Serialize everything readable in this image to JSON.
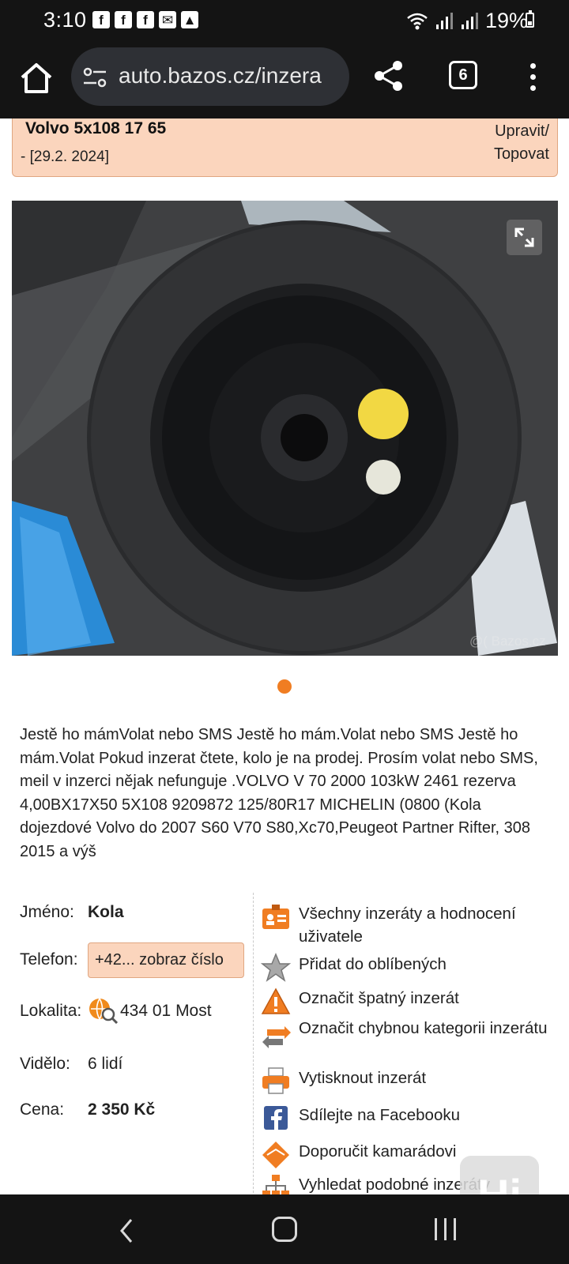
{
  "status_bar": {
    "time": "3:10",
    "notification_icons": [
      "facebook-icon",
      "facebook-icon",
      "facebook-icon",
      "mail-icon",
      "image-icon"
    ],
    "battery": "19%"
  },
  "browser": {
    "url": "auto.bazos.cz/inzera",
    "tab_count": "6"
  },
  "listing": {
    "title": "Volvo 5x108 17 65",
    "date": "- [29.2. 2024]",
    "edit_line1": "Upravit/",
    "edit_line2": "Topovat",
    "watermark": "@( Bazos.cz",
    "description": "Jestě ho mámVolat nebo SMS Jestě ho mám.Volat nebo SMS Jestě ho mám.Volat Pokud inzerat čtete, kolo je na prodej. Prosím volat nebo SMS, meil v inzerci nějak nefunguje .VOLVO V 70 2000 103kW 2461 rezerva 4,00BX17X50 5X108 9209872 125/80R17 MICHELIN (0800 (Kola dojezdové Volvo do 2007 S60 V70 S80,Xc70,Peugeot Partner Rifter, 308 2015 a výš"
  },
  "details": {
    "name_label": "Jméno:",
    "name_value": "Kola",
    "phone_label": "Telefon:",
    "phone_value": "+42... zobraz číslo",
    "location_label": "Lokalita:",
    "location_value": "434 01 Most",
    "views_label": "Vidělo:",
    "views_value": "6 lidí",
    "price_label": "Cena:",
    "price_value": "2 350 Kč"
  },
  "actions": {
    "all_listings": "Všechny inzeráty a hodnocení uživatele",
    "add_favorite": "Přidat do oblíbených",
    "report_bad": "Označit špatný inzerát",
    "report_category": "Označit chybnou kategorii inzerátu",
    "print": "Vytisknout inzerát",
    "share_facebook": "Sdílejte na Facebooku",
    "recommend": "Doporučit kamarádovi",
    "find_similar": "Vyhledat podobné inzeráty"
  },
  "badge": {
    "label": "Hi"
  },
  "colors": {
    "accent_orange": "#f07d22",
    "title_box_bg": "#fbd5bd",
    "dark_bar": "#141414"
  }
}
